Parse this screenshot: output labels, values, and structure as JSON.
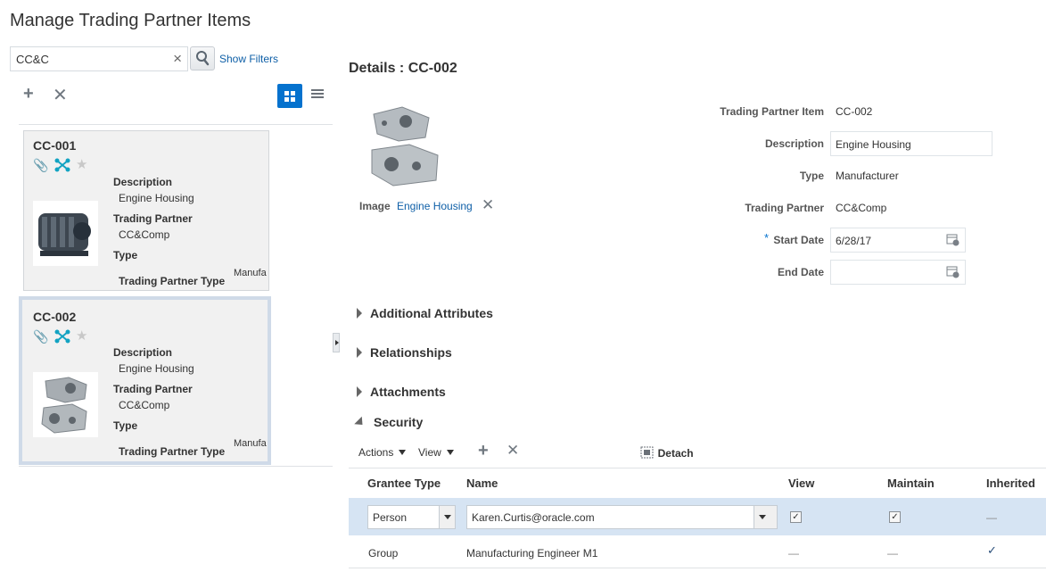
{
  "page": {
    "title": "Manage Trading Partner Items"
  },
  "search": {
    "value": "CC&C",
    "show_filters": "Show Filters"
  },
  "cards": [
    {
      "id": "CC-001",
      "description_label": "Description",
      "description": "Engine Housing",
      "trading_partner_label": "Trading Partner",
      "trading_partner": "CC&Comp",
      "type_label": "Type",
      "tp_type_label": "Trading Partner Type",
      "tp_type_value": "Manufa"
    },
    {
      "id": "CC-002",
      "description_label": "Description",
      "description": "Engine Housing",
      "trading_partner_label": "Trading Partner",
      "trading_partner": "CC&Comp",
      "type_label": "Type",
      "tp_type_label": "Trading Partner Type",
      "tp_type_value": "Manufa"
    }
  ],
  "details": {
    "title": "Details : CC-002",
    "image_label": "Image",
    "image_link": "Engine Housing",
    "fields": {
      "item_label": "Trading Partner Item",
      "item_value": "CC-002",
      "description_label": "Description",
      "description_value": "Engine Housing",
      "type_label": "Type",
      "type_value": "Manufacturer",
      "partner_label": "Trading Partner",
      "partner_value": "CC&Comp",
      "required_mark": "*",
      "start_label": "Start Date",
      "start_value": "6/28/17",
      "end_label": "End Date",
      "end_value": ""
    },
    "sections": {
      "additional": "Additional Attributes",
      "relationships": "Relationships",
      "attachments": "Attachments",
      "security": "Security"
    }
  },
  "security": {
    "toolbar": {
      "actions": "Actions",
      "view": "View",
      "detach": "Detach"
    },
    "columns": [
      "Grantee Type",
      "Name",
      "View",
      "Maintain",
      "Inherited"
    ],
    "rows": [
      {
        "grantee_type": "Person",
        "name": "Karen.Curtis@oracle.com",
        "view": true,
        "maintain": true,
        "inherited": "—"
      },
      {
        "grantee_type": "Group",
        "name": "Manufacturing Engineer M1",
        "view": "—",
        "maintain": "—",
        "inherited": "✓"
      }
    ]
  },
  "colors": {
    "accent": "#0572ce",
    "link": "#0e5fa7",
    "selected_row": "#d6e4f3"
  }
}
